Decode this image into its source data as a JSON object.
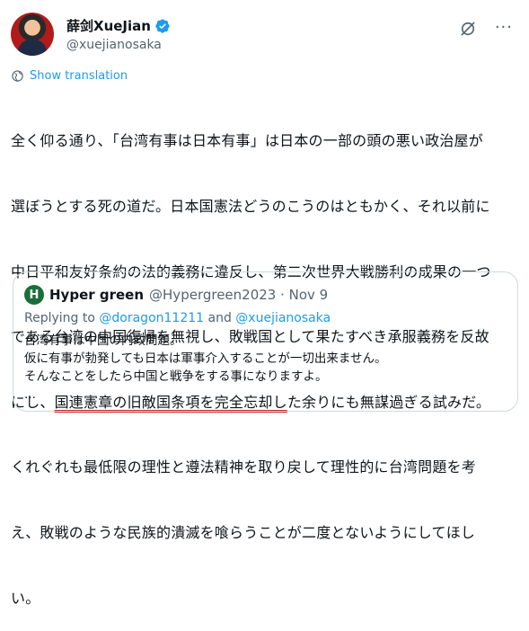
{
  "author": {
    "display_name": "薛剑XueJian",
    "handle": "@xuejianosaka",
    "verified_color": "#1d9bf0"
  },
  "header_icons": [
    "grok-icon",
    "more-icon"
  ],
  "more_label": "···",
  "translation": {
    "label": "Show translation"
  },
  "tweet": {
    "line1": "全く仰る通り、「台湾有事は日本有事」は日本の一部の頭の悪い政治屋が",
    "line2": "選ぼうとする死の道だ。日本国憲法どうのこうのはともかく、それ以前に",
    "line3": "中日平和友好条約の法的義務に違反し、第二次世界大戦勝利の成果の一つ",
    "line4": "である台湾の中国復帰を無視し、敗戦国として果たすべき承服義務を反故",
    "line5_pre": "にし、",
    "line5_underlined": "国連憲章の旧敵国条項を完全忘却し",
    "line5_post": "た余りにも無謀過ぎる試みだ。",
    "line6": "くれぐれも最低限の理性と遵法精神を取り戻して理性的に台湾問題を考",
    "line7": "え、敗戦のような民族的潰滅を喰らうことが二度とないようにしてほし",
    "line8": "い。"
  },
  "underline_color": "#c0272d",
  "quote": {
    "avatar_letter": "H",
    "avatar_color": "#1b6e3a",
    "name": "Hyper green",
    "handle_time": "@Hypergreen2023 · Nov 9",
    "reply_prefix": "Replying to ",
    "reply_mention1": "@doragon11211",
    "reply_and": " and ",
    "reply_mention2": "@xuejianosaka",
    "line1": "台湾有事は中国の内政問題。",
    "line2": "仮に有事が勃発しても日本は軍事介入することが一切出来ません。",
    "line3": "そんなことをしたら中国と戦争をする事になりますよ。",
    "line4": "..."
  }
}
